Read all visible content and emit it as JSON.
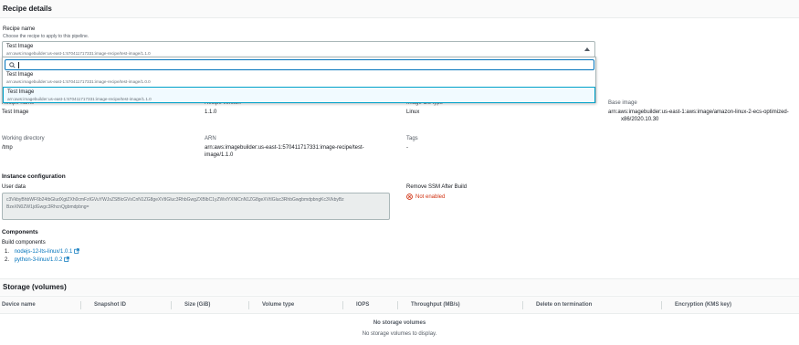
{
  "section": {
    "title": "Recipe details"
  },
  "recipe_select": {
    "label": "Recipe name",
    "description": "Choose the recipe to apply to this pipeline.",
    "selected_name": "Test Image",
    "selected_arn": "arn:aws:imagebuilder:us-east-1:570411717331:image-recipe/test-image/1.1.0",
    "search_placeholder": "",
    "options": [
      {
        "name": "Test Image",
        "arn": "arn:aws:imagebuilder:us-east-1:570411717331:image-recipe/test-image/1.0.0"
      },
      {
        "name": "Test Image",
        "arn": "arn:aws:imagebuilder:us-east-1:570411717331:image-recipe/test-image/1.1.0"
      }
    ]
  },
  "details": {
    "recipe_name_label": "Recipe name",
    "recipe_name": "Test Image",
    "recipe_version_label": "Recipe version",
    "recipe_version": "1.1.0",
    "os_type_label": "Image OS type",
    "os_type": "Linux",
    "base_image_label": "Base image",
    "base_image_line1": "arn:aws:imagebuilder:us-east-1:aws:image/amazon-linux-2-ecs-optimized-",
    "base_image_line2": "x86/2020.10.30",
    "working_dir_label": "Working directory",
    "working_dir": "/tmp",
    "arn_label": "ARN",
    "arn_line1": "arn:aws:imagebuilder:us-east-1:570411717331:image-recipe/test-",
    "arn_line2": "image/1.1.0",
    "tags_label": "Tags",
    "tags": "-"
  },
  "instance_config": {
    "heading": "Instance configuration",
    "user_data_label": "User data",
    "user_data_line1": "c3VkbyBhbWF6b24tbGludXgtZXh0cmFzIGVuYWJsZSBlcGVsCnN1ZG8geXVtIGluc3RhbGwgZXBlbC1yZWxlYXNlCnN1ZG8geXVtIGluc3RhbGwgbmdpbngKc3VkbyBz",
    "user_data_line2": "BzeXN0ZW1jdGwgc3RhcnQgbmdpbng=",
    "remove_ssm_label": "Remove SSM After Build",
    "remove_ssm_value": "Not enabled"
  },
  "components": {
    "heading": "Components",
    "build_label": "Build components",
    "items": [
      {
        "num": "1.",
        "name": "nodejs-12-lts-linux/1.0.1"
      },
      {
        "num": "2.",
        "name": "python-3-linux/1.0.2"
      }
    ]
  },
  "storage": {
    "title": "Storage (volumes)",
    "columns": [
      "Device name",
      "Snapshot ID",
      "Size (GiB)",
      "Volume type",
      "IOPS",
      "Throughput (MB/s)",
      "Delete on termination",
      "Encryption (KMS key)"
    ],
    "empty_title": "No storage volumes",
    "empty_sub": "No storage volumes to display."
  },
  "colors": {
    "link": "#0073bb",
    "error": "#d13212",
    "focus": "#0073bb"
  }
}
